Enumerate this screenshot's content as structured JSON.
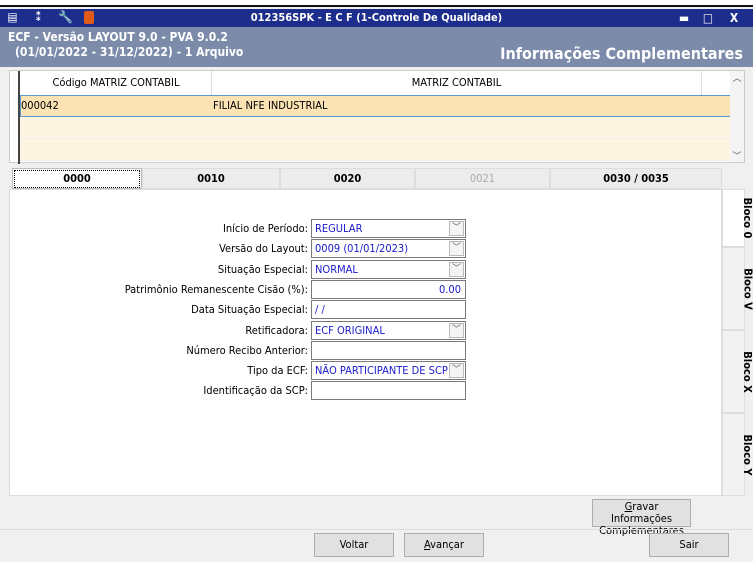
{
  "window": {
    "title": "012356SPK - E C F (1-Controle De Qualidade)",
    "icons": [
      "menu-icon",
      "traffic-light-icon",
      "wrench-icon",
      "book-icon"
    ],
    "controls": {
      "minimize": "▬",
      "maximize": "□",
      "close": "X"
    }
  },
  "header": {
    "line1": "ECF - Versão LAYOUT 9.0 - PVA 9.0.2",
    "line2": "(01/01/2022 - 31/12/2022) - 1 Arquivo",
    "section": "Informações Complementares"
  },
  "grid": {
    "columns": [
      "Código MATRIZ CONTABIL",
      "MATRIZ CONTABIL"
    ],
    "rows": [
      {
        "codigo": "000042",
        "matriz": "FILIAL NFE INDUSTRIAL"
      }
    ]
  },
  "tabs": [
    {
      "label": "0000",
      "active": true
    },
    {
      "label": "0010"
    },
    {
      "label": "0020"
    },
    {
      "label": "0021",
      "disabled": true
    },
    {
      "label": "0030 / 0035"
    }
  ],
  "side_tabs": [
    "Bloco 0",
    "Bloco V",
    "Bloco X",
    "Bloco Y"
  ],
  "form": [
    {
      "label": "Início de Período:",
      "value": "REGULAR",
      "type": "select"
    },
    {
      "label": "Versão do Layout:",
      "value": "0009 (01/01/2023)",
      "type": "select"
    },
    {
      "label": "Situação Especial:",
      "value": "NORMAL",
      "type": "select"
    },
    {
      "label": "Patrimônio Remanescente Cisão (%):",
      "value": "0.00",
      "type": "number"
    },
    {
      "label": "Data Situação Especial:",
      "value": " / /",
      "type": "date"
    },
    {
      "label": "Retificadora:",
      "value": "ECF ORIGINAL",
      "type": "select"
    },
    {
      "label": "Número Recibo Anterior:",
      "value": "",
      "type": "text"
    },
    {
      "label": "Tipo da ECF:",
      "value": "NÃO PARTICIPANTE DE SCP",
      "type": "select"
    },
    {
      "label": "Identificação da SCP:",
      "value": "",
      "type": "text"
    }
  ],
  "buttons": {
    "gravar_line1": "Gravar Informações",
    "gravar_line2": "Complementares",
    "gravar_underline_char": "G",
    "voltar": "Voltar",
    "avancar": "Avançar",
    "avancar_underline_char": "A",
    "sair": "Sair"
  },
  "colors": {
    "titlebar": "#1c2d8c",
    "header": "#7c8ba9",
    "selected_row": "#fbe3b3",
    "input_text": "#1a1acc"
  }
}
